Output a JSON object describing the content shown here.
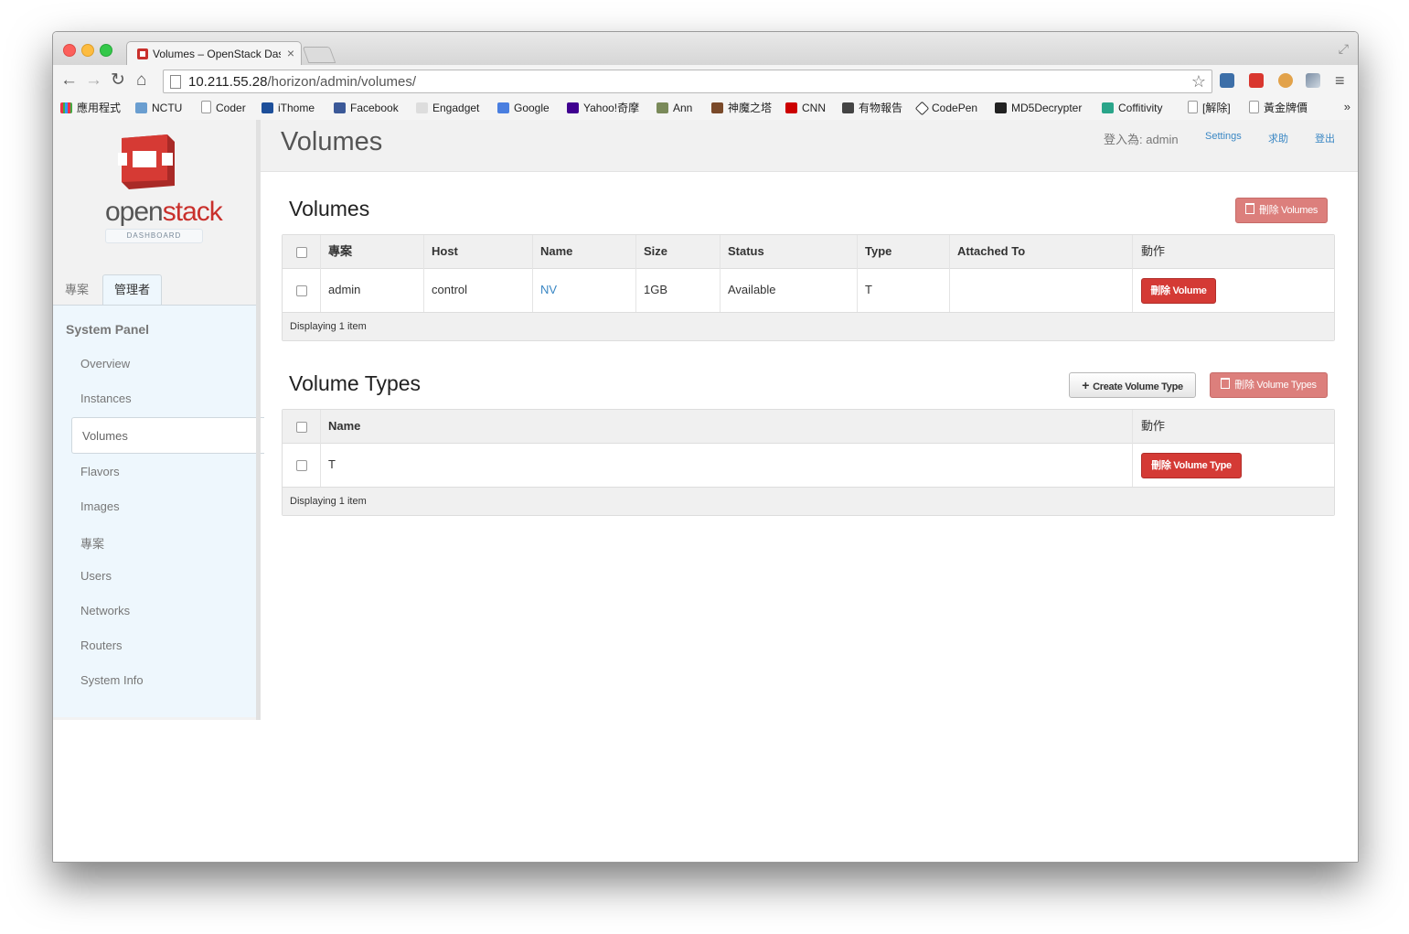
{
  "browser": {
    "tab_title": "Volumes – OpenStack Dashboard",
    "url_host": "10.211.55.28",
    "url_path": "/horizon/admin/volumes/",
    "bookmarks": [
      "應用程式",
      "NCTU",
      "Coder",
      "iThome",
      "Facebook",
      "Engadget",
      "Google",
      "Yahoo!奇摩",
      "Ann",
      "神魔之塔",
      "CNN",
      "有物報告",
      "CodePen",
      "MD5Decrypter",
      "Coffitivity",
      "[解除]",
      "黃金牌價"
    ],
    "bookmarks_more": "»"
  },
  "logo": {
    "text_open": "open",
    "text_stack": "stack",
    "sub": "DASHBOARD"
  },
  "sidebar": {
    "tabs": [
      "專案",
      "管理者"
    ],
    "panel_title": "System Panel",
    "items": [
      "Overview",
      "Instances",
      "Volumes",
      "Flavors",
      "Images",
      "專案",
      "Users",
      "Networks",
      "Routers",
      "System Info"
    ]
  },
  "header": {
    "title": "Volumes",
    "logged_in": "登入為: admin",
    "settings": "Settings",
    "help": "求助",
    "logout": "登出"
  },
  "volumes": {
    "title": "Volumes",
    "delete_selected": "刪除 Volumes",
    "columns": [
      "專案",
      "Host",
      "Name",
      "Size",
      "Status",
      "Type",
      "Attached To",
      "動作"
    ],
    "rows": [
      {
        "project": "admin",
        "host": "control",
        "name": "NV",
        "size": "1GB",
        "status": "Available",
        "type": "T",
        "attached": "",
        "action": "刪除 Volume"
      }
    ],
    "footer": "Displaying 1 item"
  },
  "volume_types": {
    "title": "Volume Types",
    "create": "Create Volume Type",
    "delete_selected": "刪除 Volume Types",
    "columns": [
      "Name",
      "動作"
    ],
    "rows": [
      {
        "name": "T",
        "action": "刪除 Volume Type"
      }
    ],
    "footer": "Displaying 1 item"
  },
  "colors": {
    "accent": "#3a87c4",
    "danger": "#d43a35",
    "danger_light": "#dc7f7c",
    "brand": "#c9302c"
  }
}
